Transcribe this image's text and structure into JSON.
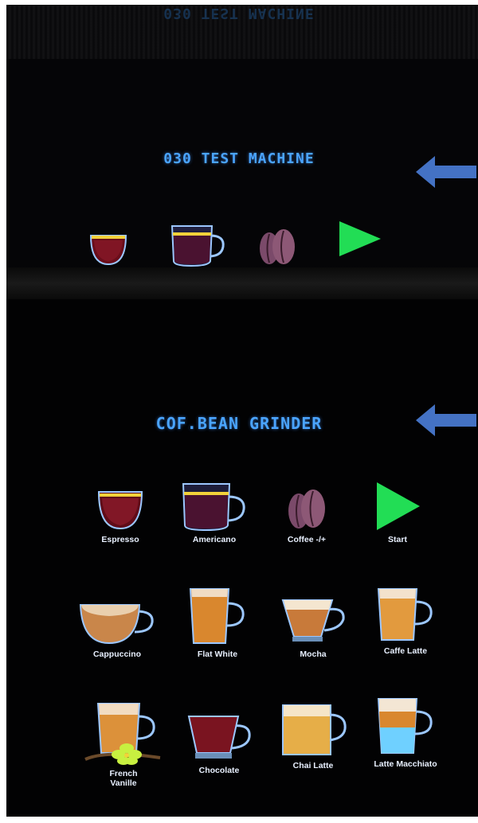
{
  "top_screen": {
    "title": "030 TEST MACHINE",
    "icons": [
      "espresso-cup-icon",
      "americano-cup-icon",
      "coffee-bean-icon",
      "play-icon"
    ]
  },
  "bottom_screen": {
    "title": "COF.BEAN GRINDER",
    "rows": [
      [
        {
          "label": "Espresso",
          "icon": "espresso-cup-icon"
        },
        {
          "label": "Americano",
          "icon": "americano-cup-icon"
        },
        {
          "label": "Coffee -/+",
          "icon": "coffee-bean-icon"
        },
        {
          "label": "Start",
          "icon": "play-icon"
        }
      ],
      [
        {
          "label": "Cappuccino",
          "icon": "cappuccino-cup-icon"
        },
        {
          "label": "Flat White",
          "icon": "flat-white-glass-icon"
        },
        {
          "label": "Mocha",
          "icon": "mocha-cup-icon"
        },
        {
          "label": "Caffe Latte",
          "icon": "caffe-latte-glass-icon"
        }
      ],
      [
        {
          "label": "French Vanille",
          "icon": "french-vanille-glass-icon"
        },
        {
          "label": "Chocolate",
          "icon": "chocolate-cup-icon"
        },
        {
          "label": "Chai Latte",
          "icon": "chai-latte-glass-icon"
        },
        {
          "label": "Latte Macchiato",
          "icon": "latte-macchiato-glass-icon"
        }
      ]
    ]
  },
  "colors": {
    "title_blue": "#4aa4ff",
    "arrow_blue": "#4472c4",
    "play_green": "#22dd55",
    "label_white": "#e8f0ff"
  }
}
